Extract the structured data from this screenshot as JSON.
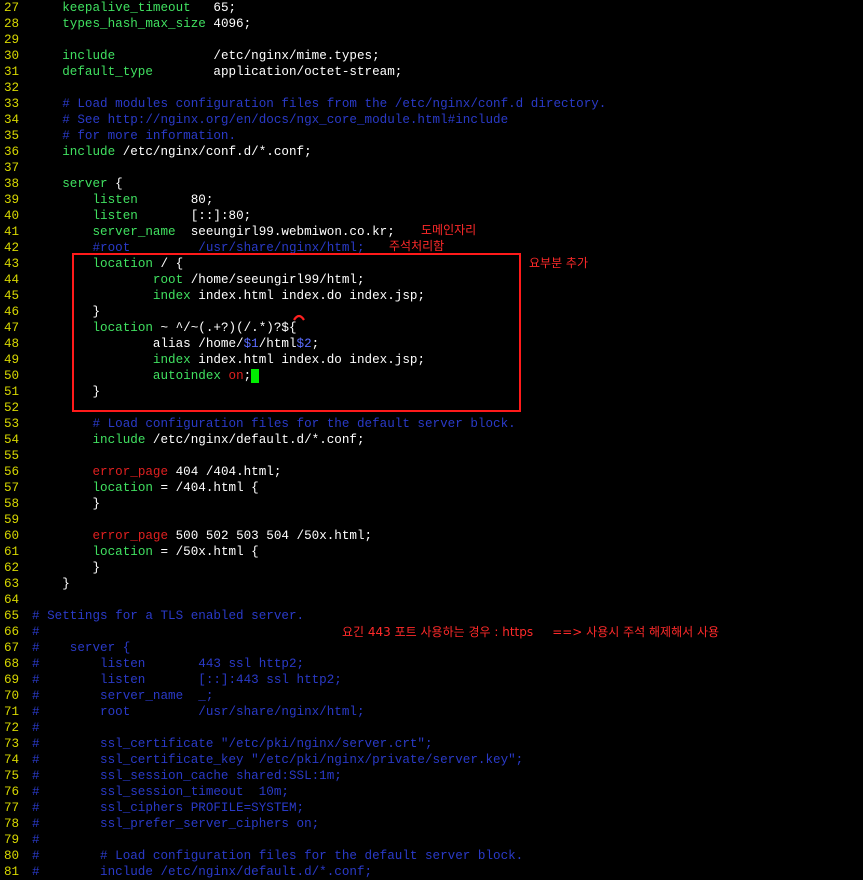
{
  "editor": {
    "lines": [
      {
        "n": "27",
        "segs": [
          {
            "t": "    "
          },
          {
            "t": "keepalive_timeout",
            "c": "kw"
          },
          {
            "t": "   65;"
          }
        ]
      },
      {
        "n": "28",
        "segs": [
          {
            "t": "    "
          },
          {
            "t": "types_hash_max_size",
            "c": "kw"
          },
          {
            "t": " 4096;"
          }
        ]
      },
      {
        "n": "29",
        "segs": []
      },
      {
        "n": "30",
        "segs": [
          {
            "t": "    "
          },
          {
            "t": "include",
            "c": "kw"
          },
          {
            "t": "             /etc/nginx/mime.types;"
          }
        ]
      },
      {
        "n": "31",
        "segs": [
          {
            "t": "    "
          },
          {
            "t": "default_type",
            "c": "kw"
          },
          {
            "t": "        application/octet-stream;"
          }
        ]
      },
      {
        "n": "32",
        "segs": []
      },
      {
        "n": "33",
        "segs": [
          {
            "t": "    # Load modules configuration files from the /etc/nginx/conf.d directory.",
            "c": "cm"
          }
        ]
      },
      {
        "n": "34",
        "segs": [
          {
            "t": "    # See http://nginx.org/en/docs/ngx_core_module.html#include",
            "c": "cm"
          }
        ]
      },
      {
        "n": "35",
        "segs": [
          {
            "t": "    # for more information.",
            "c": "cm"
          }
        ]
      },
      {
        "n": "36",
        "segs": [
          {
            "t": "    "
          },
          {
            "t": "include",
            "c": "kw"
          },
          {
            "t": " /etc/nginx/conf.d/*.conf;"
          }
        ]
      },
      {
        "n": "37",
        "segs": []
      },
      {
        "n": "38",
        "segs": [
          {
            "t": "    "
          },
          {
            "t": "server",
            "c": "kw"
          },
          {
            "t": " {"
          }
        ]
      },
      {
        "n": "39",
        "segs": [
          {
            "t": "        "
          },
          {
            "t": "listen",
            "c": "kw"
          },
          {
            "t": "       80;"
          }
        ]
      },
      {
        "n": "40",
        "segs": [
          {
            "t": "        "
          },
          {
            "t": "listen",
            "c": "kw"
          },
          {
            "t": "       [::]:80;"
          }
        ]
      },
      {
        "n": "41",
        "segs": [
          {
            "t": "        "
          },
          {
            "t": "server_name",
            "c": "kw"
          },
          {
            "t": "  seeungirl99.webmiwon.co.kr;"
          }
        ]
      },
      {
        "n": "42",
        "segs": [
          {
            "t": "        #root         /usr/share/nginx/html;",
            "c": "cm"
          }
        ]
      },
      {
        "n": "43",
        "segs": [
          {
            "t": "        "
          },
          {
            "t": "location",
            "c": "kw"
          },
          {
            "t": " / {"
          }
        ]
      },
      {
        "n": "44",
        "segs": [
          {
            "t": "                "
          },
          {
            "t": "root",
            "c": "kw"
          },
          {
            "t": " /home/seeungirl99/html;"
          }
        ]
      },
      {
        "n": "45",
        "segs": [
          {
            "t": "                "
          },
          {
            "t": "index",
            "c": "kw"
          },
          {
            "t": " index.html index.do index.jsp;"
          }
        ]
      },
      {
        "n": "46",
        "segs": [
          {
            "t": "        }"
          }
        ]
      },
      {
        "n": "47",
        "segs": [
          {
            "t": "        "
          },
          {
            "t": "location",
            "c": "kw"
          },
          {
            "t": " ~ ^/~(.+?)(/.*)?${"
          }
        ]
      },
      {
        "n": "48",
        "segs": [
          {
            "t": "                alias /home/"
          },
          {
            "t": "$1",
            "c": "blue"
          },
          {
            "t": "/html"
          },
          {
            "t": "$2",
            "c": "blue"
          },
          {
            "t": ";"
          }
        ]
      },
      {
        "n": "49",
        "segs": [
          {
            "t": "                "
          },
          {
            "t": "index",
            "c": "kw"
          },
          {
            "t": " index.html index.do index.jsp;"
          }
        ]
      },
      {
        "n": "50",
        "segs": [
          {
            "t": "                "
          },
          {
            "t": "autoindex",
            "c": "kw"
          },
          {
            "t": " "
          },
          {
            "t": "on",
            "c": "red"
          },
          {
            "t": ";"
          },
          {
            "t": " ",
            "c": "cursor"
          }
        ]
      },
      {
        "n": "51",
        "segs": [
          {
            "t": "        }"
          }
        ]
      },
      {
        "n": "52",
        "segs": []
      },
      {
        "n": "53",
        "segs": [
          {
            "t": "        # Load configuration files for the default server block.",
            "c": "cm"
          }
        ]
      },
      {
        "n": "54",
        "segs": [
          {
            "t": "        "
          },
          {
            "t": "include",
            "c": "kw"
          },
          {
            "t": " /etc/nginx/default.d/*.conf;"
          }
        ]
      },
      {
        "n": "55",
        "segs": []
      },
      {
        "n": "56",
        "segs": [
          {
            "t": "        "
          },
          {
            "t": "error_page",
            "c": "red"
          },
          {
            "t": " 404 /404.html;"
          }
        ]
      },
      {
        "n": "57",
        "segs": [
          {
            "t": "        "
          },
          {
            "t": "location",
            "c": "kw"
          },
          {
            "t": " = /404.html {"
          }
        ]
      },
      {
        "n": "58",
        "segs": [
          {
            "t": "        }"
          }
        ]
      },
      {
        "n": "59",
        "segs": []
      },
      {
        "n": "60",
        "segs": [
          {
            "t": "        "
          },
          {
            "t": "error_page",
            "c": "red"
          },
          {
            "t": " 500 502 503 504 /50x.html;"
          }
        ]
      },
      {
        "n": "61",
        "segs": [
          {
            "t": "        "
          },
          {
            "t": "location",
            "c": "kw"
          },
          {
            "t": " = /50x.html {"
          }
        ]
      },
      {
        "n": "62",
        "segs": [
          {
            "t": "        }"
          }
        ]
      },
      {
        "n": "63",
        "segs": [
          {
            "t": "    }"
          }
        ]
      },
      {
        "n": "64",
        "segs": []
      },
      {
        "n": "65",
        "segs": [
          {
            "t": "# Settings for a TLS enabled server.",
            "c": "cm"
          }
        ]
      },
      {
        "n": "66",
        "segs": [
          {
            "t": "#",
            "c": "cm"
          }
        ]
      },
      {
        "n": "67",
        "segs": [
          {
            "t": "#    server {",
            "c": "cm"
          }
        ]
      },
      {
        "n": "68",
        "segs": [
          {
            "t": "#        listen       443 ssl http2;",
            "c": "cm"
          }
        ]
      },
      {
        "n": "69",
        "segs": [
          {
            "t": "#        listen       [::]:443 ssl http2;",
            "c": "cm"
          }
        ]
      },
      {
        "n": "70",
        "segs": [
          {
            "t": "#        server_name  _;",
            "c": "cm"
          }
        ]
      },
      {
        "n": "71",
        "segs": [
          {
            "t": "#        root         /usr/share/nginx/html;",
            "c": "cm"
          }
        ]
      },
      {
        "n": "72",
        "segs": [
          {
            "t": "#",
            "c": "cm"
          }
        ]
      },
      {
        "n": "73",
        "segs": [
          {
            "t": "#        ssl_certificate \"/etc/pki/nginx/server.crt\";",
            "c": "cm"
          }
        ]
      },
      {
        "n": "74",
        "segs": [
          {
            "t": "#        ssl_certificate_key \"/etc/pki/nginx/private/server.key\";",
            "c": "cm"
          }
        ]
      },
      {
        "n": "75",
        "segs": [
          {
            "t": "#        ssl_session_cache shared:SSL:1m;",
            "c": "cm"
          }
        ]
      },
      {
        "n": "76",
        "segs": [
          {
            "t": "#        ssl_session_timeout  10m;",
            "c": "cm"
          }
        ]
      },
      {
        "n": "77",
        "segs": [
          {
            "t": "#        ssl_ciphers PROFILE=SYSTEM;",
            "c": "cm"
          }
        ]
      },
      {
        "n": "78",
        "segs": [
          {
            "t": "#        ssl_prefer_server_ciphers on;",
            "c": "cm"
          }
        ]
      },
      {
        "n": "79",
        "segs": [
          {
            "t": "#",
            "c": "cm"
          }
        ]
      },
      {
        "n": "80",
        "segs": [
          {
            "t": "#        # Load configuration files for the default server block.",
            "c": "cm"
          }
        ]
      },
      {
        "n": "81",
        "segs": [
          {
            "t": "#        include /etc/nginx/default.d/*.conf;",
            "c": "cm"
          }
        ]
      }
    ]
  },
  "annotations": {
    "domain_note": "도메인자리",
    "comment_note": "주석처리함",
    "added_note": "요부분 추가",
    "tls_note": "요긴 443 포트 사용하는 경우 : https     ==> 사용시 주석 해제해서 사용"
  },
  "colors": {
    "keyword": "#40e060",
    "comment": "#2a3ac8",
    "line_number": "#d8d800",
    "annotation": "#ff2a2a",
    "cursor": "#00ee00"
  }
}
